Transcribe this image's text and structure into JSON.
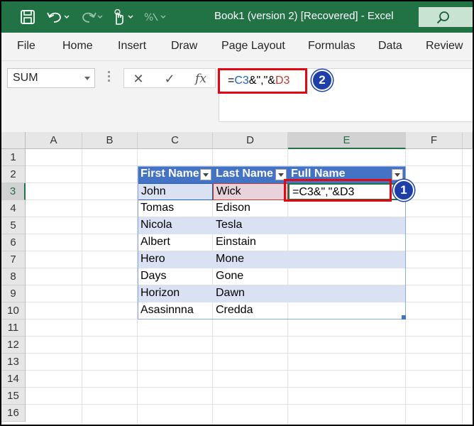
{
  "titlebar": {
    "title": "Book1 (version 2) [Recovered]  -  Excel",
    "icons": [
      "save-icon",
      "undo-icon",
      "redo-icon",
      "touch-mode-icon",
      "format-icon",
      "search-icon"
    ]
  },
  "ribbon": {
    "tabs": [
      "File",
      "Home",
      "Insert",
      "Draw",
      "Page Layout",
      "Formulas",
      "Data",
      "Review"
    ]
  },
  "formula_bar": {
    "name_box": "SUM",
    "cancel_symbol": "✕",
    "enter_symbol": "✓",
    "fx_label": "fx",
    "formula_parts": [
      "=",
      "C3",
      "&\",\"&",
      "D3"
    ]
  },
  "grid": {
    "columns": [
      "A",
      "B",
      "C",
      "D",
      "E",
      "F"
    ],
    "rows": [
      "1",
      "2",
      "3",
      "4",
      "5",
      "6",
      "7",
      "8",
      "9",
      "10",
      "11",
      "12",
      "13",
      "14",
      "15",
      "16"
    ],
    "selected_column": "E",
    "selected_row": "3"
  },
  "table": {
    "headers": [
      "First Name",
      "Last Name",
      "Full Name"
    ],
    "rows": [
      [
        "John",
        "Wick",
        "=C3&\",\"&D3"
      ],
      [
        "Tomas",
        "Edison",
        ""
      ],
      [
        "Nicola",
        "Tesla",
        ""
      ],
      [
        "Albert",
        "Einstain",
        ""
      ],
      [
        "Hero",
        "Mone",
        ""
      ],
      [
        "Days",
        "Gone",
        ""
      ],
      [
        "Horizon",
        "Dawn",
        ""
      ],
      [
        "Asasinnna",
        "Credda",
        ""
      ]
    ]
  },
  "annotations": {
    "step1": "1",
    "step2": "2"
  },
  "colors": {
    "excel_green": "#217346",
    "table_header": "#4472c4",
    "table_band": "#d9e1f2",
    "highlight_red": "#e30613",
    "badge_blue": "#1e3fa8"
  }
}
